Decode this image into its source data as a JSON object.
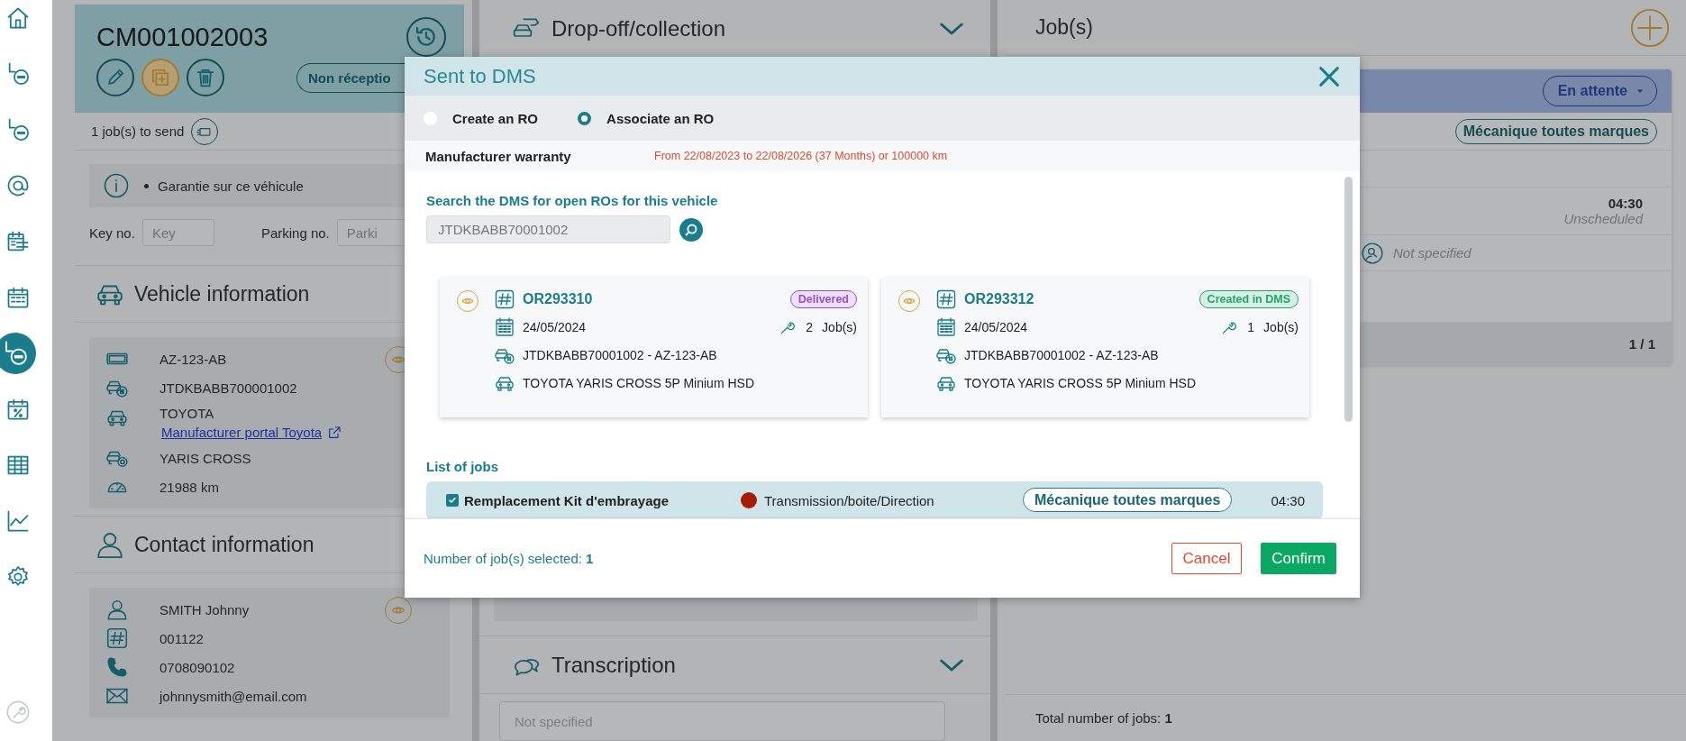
{
  "sidebar": {
    "items": [
      {
        "kind": "home",
        "selected": false
      },
      {
        "kind": "workflow",
        "selected": false
      },
      {
        "kind": "workflow",
        "selected": false
      },
      {
        "kind": "mail",
        "selected": false
      },
      {
        "kind": "planning",
        "selected": false
      },
      {
        "kind": "calendar",
        "selected": false
      },
      {
        "kind": "workflow",
        "selected": true
      },
      {
        "kind": "discount",
        "selected": false
      },
      {
        "kind": "table",
        "selected": false
      },
      {
        "kind": "chart",
        "selected": false
      },
      {
        "kind": "settings",
        "selected": false
      }
    ],
    "bottom_item": {
      "kind": "tools"
    }
  },
  "repair_order": {
    "number": "CM001002003",
    "status": "Non réceptio",
    "send_count": "1 job(s) to send",
    "notes": [
      "Garantie sur ce véhicule"
    ],
    "key": {
      "label": "Key no.",
      "placeholder": "Key"
    },
    "parking": {
      "label": "Parking no.",
      "placeholder": "Parki"
    }
  },
  "vehicle": {
    "title": "Vehicle information",
    "plate": "AZ-123-AB",
    "vin": "JTDKBABB700001002",
    "make": "TOYOTA",
    "portal_link": "Manufacturer portal Toyota",
    "model": "YARIS CROSS",
    "mileage": "21988 km"
  },
  "contact": {
    "title": "Contact information",
    "name": "SMITH Johnny",
    "customer_no": "001122",
    "phone": "0708090102",
    "email": "johnnysmith@email.com"
  },
  "middle": {
    "sections": [
      {
        "title": "Drop-off/collection"
      },
      {
        "title": "Transcription",
        "placeholder": "Not specified"
      }
    ]
  },
  "jobs_panel": {
    "title": "Job(s)",
    "status": "En attente",
    "category": "Mécanique toutes marques",
    "duration": "04:30",
    "schedule": "Unscheduled",
    "technician": "Not specified",
    "pagination": "1 / 1",
    "total": "Total number of jobs: **1**"
  },
  "modal": {
    "title": "Sent to DMS",
    "options": [
      {
        "label": "Create an RO",
        "selected": false
      },
      {
        "label": "Associate an RO",
        "selected": true
      }
    ],
    "warranty": {
      "label": "Manufacturer warranty",
      "value": "From 22/08/2023 to 22/08/2026 (37 Months) or 100000 km"
    },
    "search": {
      "label": "Search the DMS for open ROs for this vehicle",
      "value": "JTDKBABB70001002"
    },
    "ro_cards": [
      {
        "number": "OR293310",
        "status": {
          "label": "Delivered",
          "color": "#9b4dd6"
        },
        "date": "24/05/2024",
        "job_count": "2",
        "job_label": "Job(s)",
        "vehicle": "JTDKBABB70001002 - AZ-123-AB",
        "model": "TOYOTA YARIS CROSS 5P Minium HSD"
      },
      {
        "number": "OR293312",
        "status": {
          "label": "Created in DMS",
          "color": "#1ea86a"
        },
        "date": "24/05/2024",
        "job_count": "1",
        "job_label": "Job(s)",
        "vehicle": "JTDKBABB70001002 - AZ-123-AB",
        "model": "TOYOTA YARIS CROSS 5P Minium HSD"
      }
    ],
    "jobs_label": "List of jobs",
    "jobs": [
      {
        "checked": true,
        "name": "Remplacement Kit d'embrayage",
        "color": "#a81c07",
        "category": "Transmission/boite/Direction",
        "tag": "Mécanique toutes marques",
        "duration": "04:30"
      }
    ],
    "selected_count": "Number of job(s) selected: **1**",
    "buttons": [
      {
        "kind": "cancel",
        "label": "Cancel"
      },
      {
        "kind": "confirm",
        "label": "Confirm"
      }
    ]
  }
}
